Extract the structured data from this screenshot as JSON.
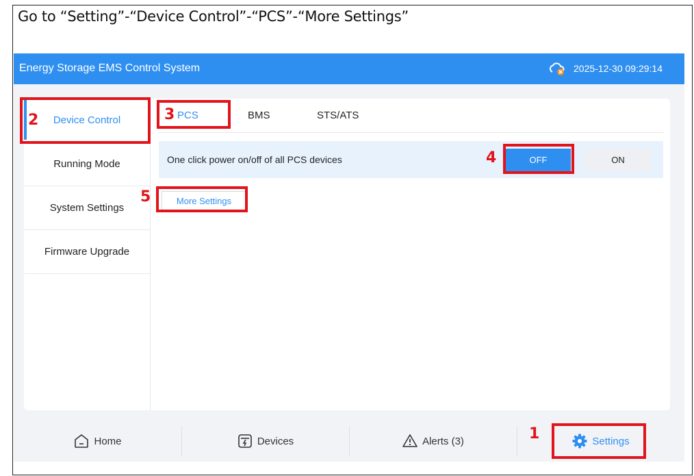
{
  "instruction": "Go to “Setting”-“Device Control”-“PCS”-“More Settings”",
  "header": {
    "title": "Energy Storage EMS Control System",
    "datetime": "2025-12-30 09:29:14",
    "cloud_icon": "cloud-disconnected-icon"
  },
  "sidebar": {
    "items": [
      {
        "label": "Device Control",
        "active": true
      },
      {
        "label": "Running Mode"
      },
      {
        "label": "System Settings"
      },
      {
        "label": "Firmware Upgrade"
      }
    ]
  },
  "tabs": [
    {
      "label": "PCS",
      "active": true
    },
    {
      "label": "BMS"
    },
    {
      "label": "STS/ATS"
    }
  ],
  "power": {
    "label": "One click power on/off of all PCS devices",
    "off_label": "OFF",
    "on_label": "ON",
    "selected": "OFF"
  },
  "more_settings_label": "More Settings",
  "bottom_nav": [
    {
      "label": "Home",
      "icon": "home-icon"
    },
    {
      "label": "Devices",
      "icon": "devices-icon"
    },
    {
      "label": "Alerts (3)",
      "icon": "alert-icon"
    },
    {
      "label": "Settings",
      "icon": "gear-icon",
      "active": true
    }
  ],
  "callouts": [
    "1",
    "2",
    "3",
    "4",
    "5"
  ],
  "colors": {
    "accent": "#2f8ff0",
    "highlight": "#e1141c"
  }
}
